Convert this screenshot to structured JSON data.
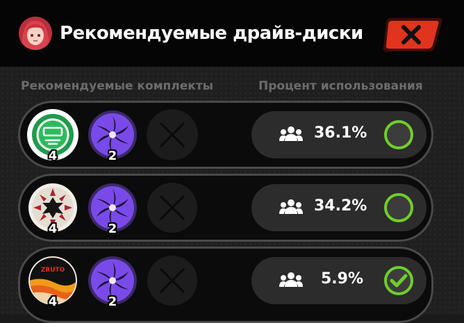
{
  "header": {
    "title": "Рекомендуемые драйв-диски"
  },
  "columns": {
    "sets_label": "Рекомендуемые комплекты",
    "usage_label": "Процент использования"
  },
  "rows": [
    {
      "discs": [
        {
          "icon": "green-set-disc-icon",
          "count": "4"
        },
        {
          "icon": "purple-swirl-disc-icon",
          "count": "2"
        },
        {
          "icon": "empty-slot-x-icon",
          "count": ""
        }
      ],
      "usage": "36.1%",
      "selected": false
    },
    {
      "discs": [
        {
          "icon": "white-red-set-disc-icon",
          "count": "4"
        },
        {
          "icon": "purple-swirl-disc-icon",
          "count": "2"
        },
        {
          "icon": "empty-slot-x-icon",
          "count": ""
        }
      ],
      "usage": "34.2%",
      "selected": false
    },
    {
      "discs": [
        {
          "icon": "orange-wave-disc-icon",
          "count": "4"
        },
        {
          "icon": "purple-swirl-disc-icon",
          "count": "2"
        },
        {
          "icon": "empty-slot-x-icon",
          "count": ""
        }
      ],
      "usage": "5.9%",
      "selected": true
    }
  ],
  "colors": {
    "accent_red": "#e0341f",
    "toggle_green": "#6fcf2a",
    "purple": "#7a4ae8"
  }
}
